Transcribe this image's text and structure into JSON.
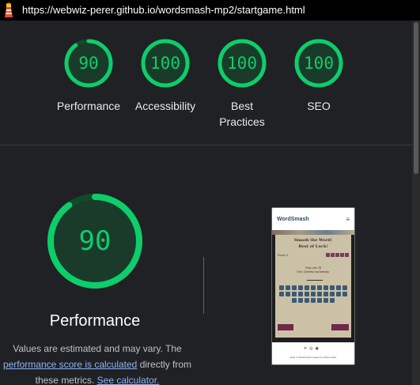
{
  "browser": {
    "url": "https://webwiz-perer.github.io/wordsmash-mp2/startgame.html"
  },
  "colors": {
    "pass": "#0cce6b",
    "pass_track": "#0f4a2c",
    "link": "#8ab4f8",
    "background": "#202124"
  },
  "gauges": [
    {
      "score": 90,
      "label": "Performance"
    },
    {
      "score": 100,
      "label": "Accessibility"
    },
    {
      "score": 100,
      "label": "Best Practices"
    },
    {
      "score": 100,
      "label": "SEO"
    }
  ],
  "performance": {
    "score": 90,
    "label": "Performance",
    "note_prefix": "Values are estimated and may vary. The ",
    "note_link1": "performance score is calculated",
    "note_middle": " directly from these metrics. ",
    "note_link2": "See calculator."
  }
}
